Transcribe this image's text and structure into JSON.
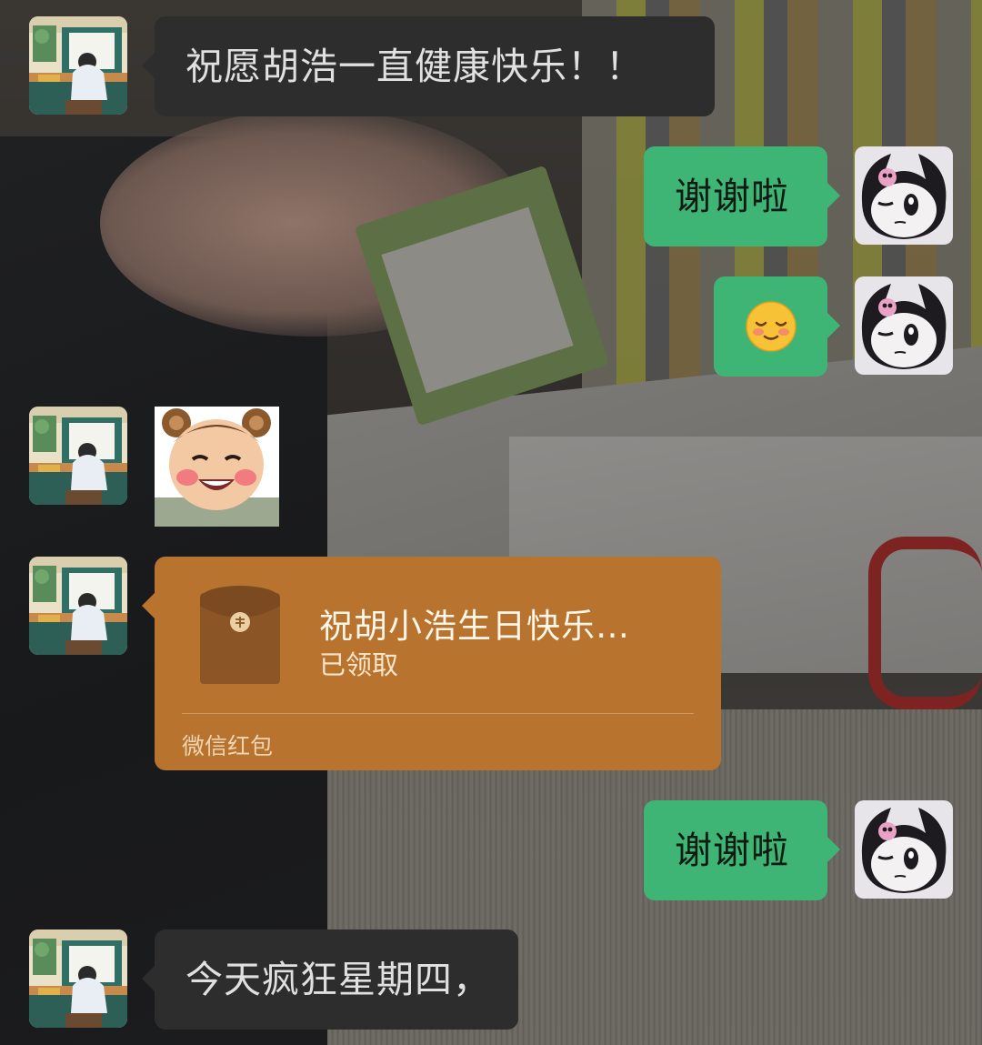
{
  "chat": {
    "messages": [
      {
        "side": "left",
        "type": "text",
        "text": "祝愿胡浩一直健康快乐！！"
      },
      {
        "side": "right",
        "type": "text",
        "text": "谢谢啦"
      },
      {
        "side": "right",
        "type": "emoji",
        "emoji": "😌"
      },
      {
        "side": "left",
        "type": "sticker",
        "sticker": "bear-ears-baby-sticker"
      },
      {
        "side": "left",
        "type": "red_packet",
        "title": "祝胡小浩生日快乐…",
        "status": "已领取",
        "footer": "微信红包"
      },
      {
        "side": "right",
        "type": "text",
        "text": "谢谢啦"
      },
      {
        "side": "left",
        "type": "text",
        "text": "今天疯狂星期四，"
      }
    ]
  },
  "colors": {
    "incoming_bubble": "#2d2d2d",
    "outgoing_bubble": "#3eb575",
    "red_packet": "#b8742e"
  },
  "icons": {
    "contact_avatar": "illustrated-girl-at-desk-avatar",
    "self_avatar": "kuromi-avatar",
    "red_packet_icon": "red-envelope-icon"
  }
}
